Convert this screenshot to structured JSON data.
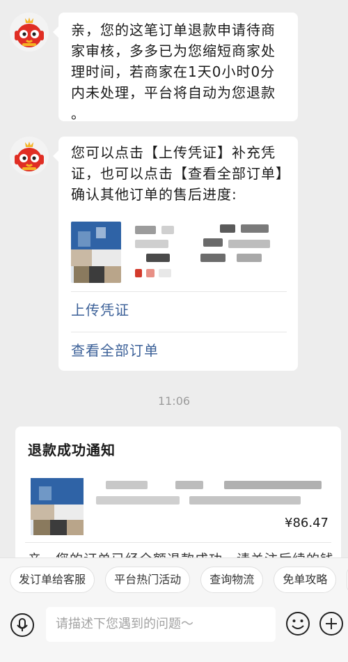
{
  "messages": [
    {
      "text": "亲，您的这笔订单退款申请待商家审核，多多已为您缩短商家处理时间，若商家在1天0小时0分内未处理，平台将自动为您退款 。"
    },
    {
      "text": "您可以点击【上传凭证】补充凭证，也可以点击【查看全部订单】确认其他订单的售后进度:",
      "links": [
        "上传凭证",
        "查看全部订单"
      ]
    }
  ],
  "timestamp": "11:06",
  "notification": {
    "title": "退款成功通知",
    "price": "¥86.47",
    "truncated_text": "亲，您的订单已经全额退款成功，请关注后续的钱"
  },
  "quick_actions": [
    "发订单给客服",
    "平台热门活动",
    "查询物流",
    "免单攻略"
  ],
  "input": {
    "placeholder": "请描述下您遇到的问题～"
  },
  "colors": {
    "link": "#3a5f97",
    "avatar_red": "#e02e24"
  }
}
